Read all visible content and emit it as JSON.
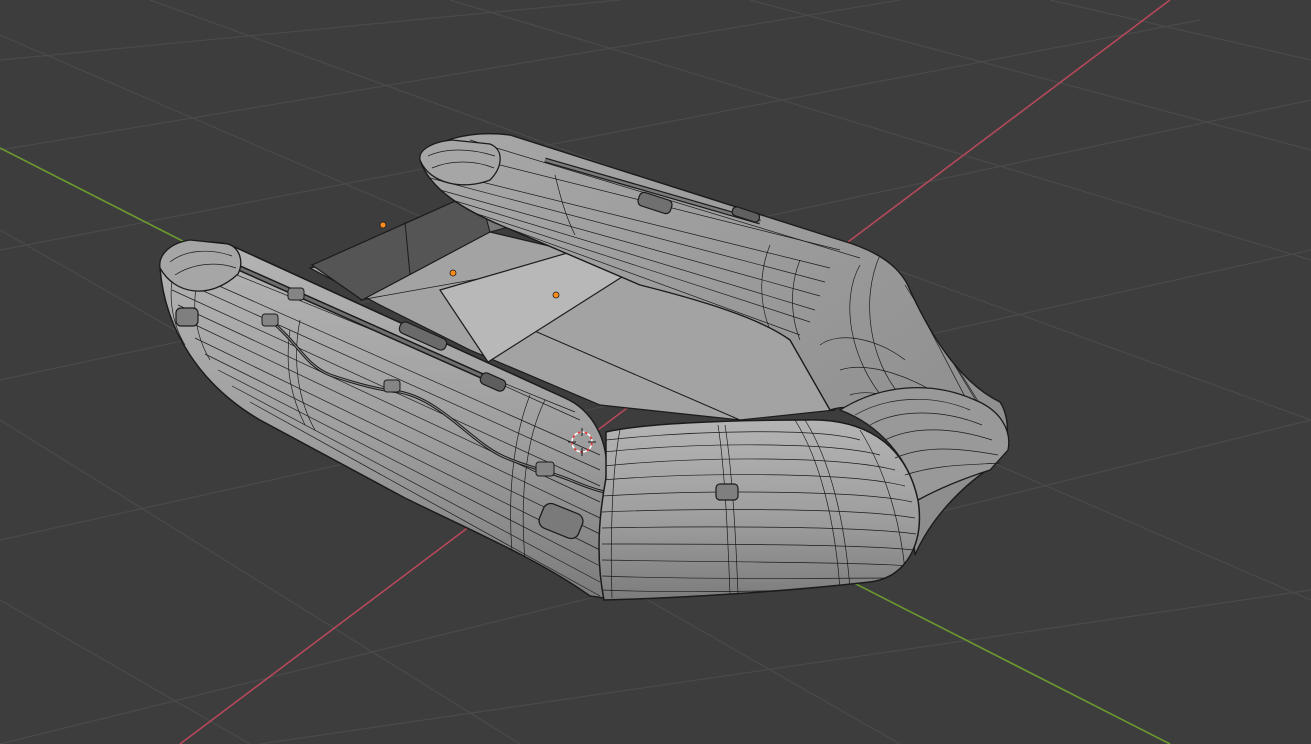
{
  "viewport": {
    "mode": "3d-viewport",
    "shading": "solid-wireframe-overlay",
    "background_color": "#3d3d3d",
    "grid_color": "#4a4a4a",
    "x_axis_color": "#b5485a",
    "y_axis_color": "#6b9a2f"
  },
  "scene": {
    "object": "inflatable-boat",
    "mesh_color": "#9c9c9c",
    "wire_color": "#1b1b1b",
    "origin_point_color": "#ff8c1a",
    "cursor_color": "#e63b3b"
  }
}
